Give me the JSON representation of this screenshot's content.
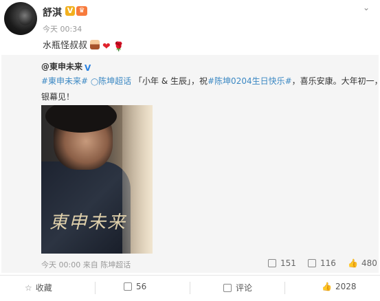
{
  "post": {
    "author": "舒淇",
    "time": "今天 00:34",
    "text": "水瓶怪叔叔",
    "verified_badge": "V"
  },
  "repost": {
    "author": "@東申未来",
    "line1": {
      "topic1": "#東申未来#",
      "mention": "陈坤超话",
      "quote": "「小年 & 生辰」，祝",
      "topic2": "#陈坤0204生日快乐#",
      "tail": "，喜乐安康。大年初一，"
    },
    "line2": "银幕见！",
    "photo_text": "東申未来",
    "footer": {
      "time": "今天 00:00",
      "from": "来自",
      "source": "陈坤超话"
    },
    "stats": {
      "reposts": "151",
      "comments": "116",
      "likes": "480"
    }
  },
  "actions": {
    "favorite": "收藏",
    "repost_count": "56",
    "comment": "评论",
    "like_count": "2028"
  },
  "icons": [
    "chevron-down-icon",
    "verified-icon",
    "crown-icon",
    "cake-emoji",
    "heart-emoji",
    "rose-emoji",
    "supertopic-icon",
    "repost-icon",
    "comment-icon",
    "like-icon",
    "star-icon"
  ],
  "colors": {
    "link": "#3b88c3",
    "repost_bg": "#f5f5f5",
    "badge_orange": "#f2b01e"
  }
}
